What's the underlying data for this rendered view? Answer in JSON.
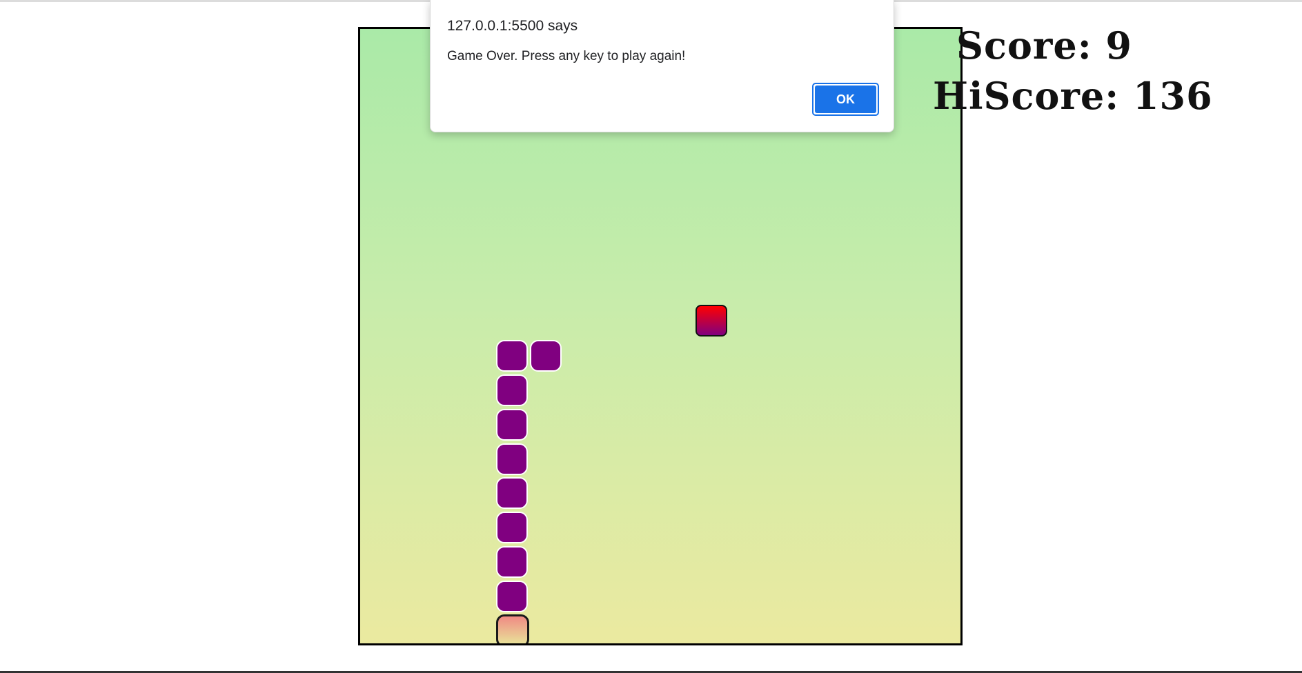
{
  "dialog": {
    "origin": "127.0.0.1:5500 says",
    "message": "Game Over. Press any key to play again!",
    "ok_label": "OK"
  },
  "scoreboard": {
    "score_text": "Score: 9",
    "hiscore_text": "HiScore: 136"
  },
  "game": {
    "board_colors": {
      "top": "#aaeaa8",
      "bottom": "#ebeaa0",
      "border": "#000000"
    },
    "snake_color": "#800080",
    "head_colors": [
      "#f08a84",
      "#e8e79a"
    ],
    "food_colors": [
      "#ff0000",
      "#800080"
    ],
    "snake_length": 10
  }
}
